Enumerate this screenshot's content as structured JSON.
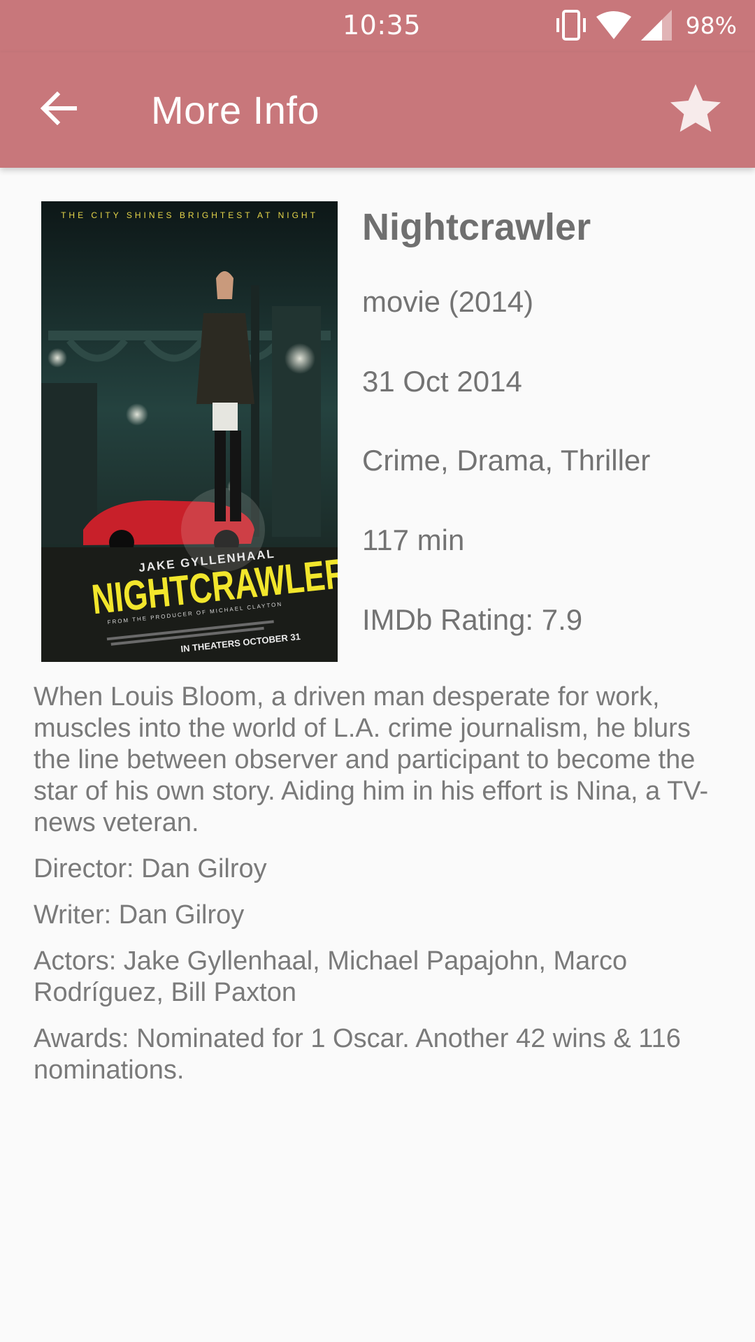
{
  "status_bar": {
    "time": "10:35",
    "battery": "98%",
    "icons": [
      "vibrate-icon",
      "wifi-icon",
      "signal-icon"
    ]
  },
  "app_bar": {
    "title": "More Info",
    "back_icon": "arrow-back-icon",
    "favorite_icon": "star-icon"
  },
  "poster": {
    "tagline": "THE CITY SHINES BRIGHTEST AT NIGHT",
    "actor": "JAKE GYLLENHAAL",
    "title": "NIGHTCRAWLER",
    "producer_line": "FROM THE PRODUCER OF MICHAEL CLAYTON",
    "release": "IN THEATERS OCTOBER 31"
  },
  "movie": {
    "title": "Nightcrawler",
    "type_year": "movie (2014)",
    "release_date": "31 Oct 2014",
    "genre": "Crime, Drama, Thriller",
    "runtime": "117 min",
    "rating": "IMDb Rating: 7.9",
    "plot": "When Louis Bloom, a driven man desperate for work, muscles into the world of L.A. crime journalism, he blurs the line between observer and participant to become the star of his own story. Aiding him in his effort is Nina, a TV-news veteran.",
    "director": "Director: Dan Gilroy",
    "writer": "Writer: Dan Gilroy",
    "actors": "Actors: Jake Gyllenhaal, Michael Papajohn, Marco Rodríguez, Bill Paxton",
    "awards": "Awards: Nominated for 1 Oscar. Another 42 wins & 116 nominations."
  },
  "colors": {
    "primary": "#c8777b",
    "background": "#fafafa",
    "text": "#737373"
  }
}
